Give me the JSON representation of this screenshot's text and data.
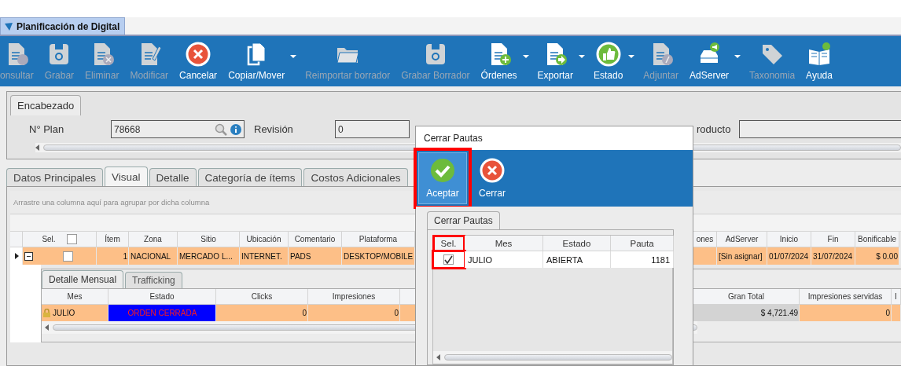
{
  "document_tab": {
    "title": "Planificación de Digital",
    "selected": true
  },
  "toolbar": [
    {
      "label": "onsultar",
      "kind": "doc-question",
      "disabled": true,
      "dropdown": false
    },
    {
      "label": "Grabar",
      "kind": "floppy",
      "disabled": true,
      "dropdown": false
    },
    {
      "label": "Eliminar",
      "kind": "doc-x",
      "disabled": true,
      "dropdown": false
    },
    {
      "label": "Modificar",
      "kind": "doc-pencil",
      "disabled": true,
      "dropdown": false
    },
    {
      "label": "Cancelar",
      "kind": "cancel",
      "disabled": false,
      "dropdown": false
    },
    {
      "label": "Copiar/Mover",
      "kind": "copy",
      "disabled": false,
      "dropdown": true
    },
    {
      "label": "Reimportar borrador",
      "kind": "folder",
      "disabled": true,
      "dropdown": false
    },
    {
      "label": "Grabar Borrador",
      "kind": "floppy",
      "disabled": true,
      "dropdown": false
    },
    {
      "label": "Órdenes",
      "kind": "doc-plus",
      "disabled": false,
      "dropdown": true
    },
    {
      "label": "Exportar",
      "kind": "doc-arrow",
      "disabled": false,
      "dropdown": true
    },
    {
      "label": "Estado",
      "kind": "thumbs",
      "disabled": false,
      "dropdown": true
    },
    {
      "label": "Adjuntar",
      "kind": "doc-clip",
      "disabled": true,
      "dropdown": false
    },
    {
      "label": "AdServer",
      "kind": "server",
      "disabled": false,
      "dropdown": true
    },
    {
      "label": "Taxonomia",
      "kind": "tag",
      "disabled": true,
      "dropdown": false
    },
    {
      "label": "Ayuda",
      "kind": "book",
      "disabled": false,
      "dropdown": false
    }
  ],
  "header_panel": {
    "tab": "Encabezado",
    "plan_label": "N° Plan",
    "plan_value": "78668",
    "revision_label": "Revisión",
    "revision_value": "0",
    "product_label": "roducto"
  },
  "tabs": [
    {
      "label": "Datos Principales",
      "selected": false
    },
    {
      "label": "Visual",
      "selected": true
    },
    {
      "label": "Detalle",
      "selected": false
    },
    {
      "label": "Categoría de ítems",
      "selected": false
    },
    {
      "label": "Costos Adicionales",
      "selected": false
    }
  ],
  "grid": {
    "group_hint": "Arrastre una columna aquí para agrupar por dicha columna",
    "columns": [
      "Sel.",
      "Ítem",
      "Zona",
      "Sitio",
      "Ubicación",
      "Comentario",
      "Plataforma",
      "ones",
      "AdServer",
      "Inicio",
      "Fin",
      "Bonificable"
    ],
    "header_checked": false,
    "rows": [
      {
        "checked": false,
        "expanded": true,
        "cells": [
          "",
          "1",
          "NACIONAL",
          "MERCADO L...",
          "INTERNET.",
          "PADS",
          "DESKTOP/MOBILE",
          "",
          "[Sin asignar]",
          "01/07/2024",
          "31/07/2024",
          "$ 0.00"
        ]
      }
    ]
  },
  "detail": {
    "tabs": [
      {
        "label": "Detalle Mensual",
        "selected": true
      },
      {
        "label": "Trafficking",
        "selected": false
      }
    ],
    "columns": [
      "Mes",
      "Estado",
      "Clicks",
      "Impresiones",
      "Gran Total",
      "Impresiones servidas",
      "I"
    ],
    "rows": [
      {
        "locked": true,
        "cells": [
          "JULIO",
          "ORDEN CERRADA",
          "0",
          "0",
          "$ 4,721.49",
          "0",
          ""
        ]
      }
    ]
  },
  "dialog": {
    "title": "Cerrar Pautas",
    "buttons": [
      {
        "label": "Aceptar",
        "kind": "check",
        "highlighted": true
      },
      {
        "label": "Cerrar",
        "kind": "cancel",
        "highlighted": false
      }
    ],
    "tab": "Cerrar Pautas",
    "columns": [
      "Sel.",
      "Mes",
      "Estado",
      "Pauta"
    ],
    "rows": [
      {
        "checked": true,
        "highlighted": true,
        "cells": [
          "",
          "JULIO",
          "ABIERTA",
          "1181"
        ]
      }
    ]
  }
}
